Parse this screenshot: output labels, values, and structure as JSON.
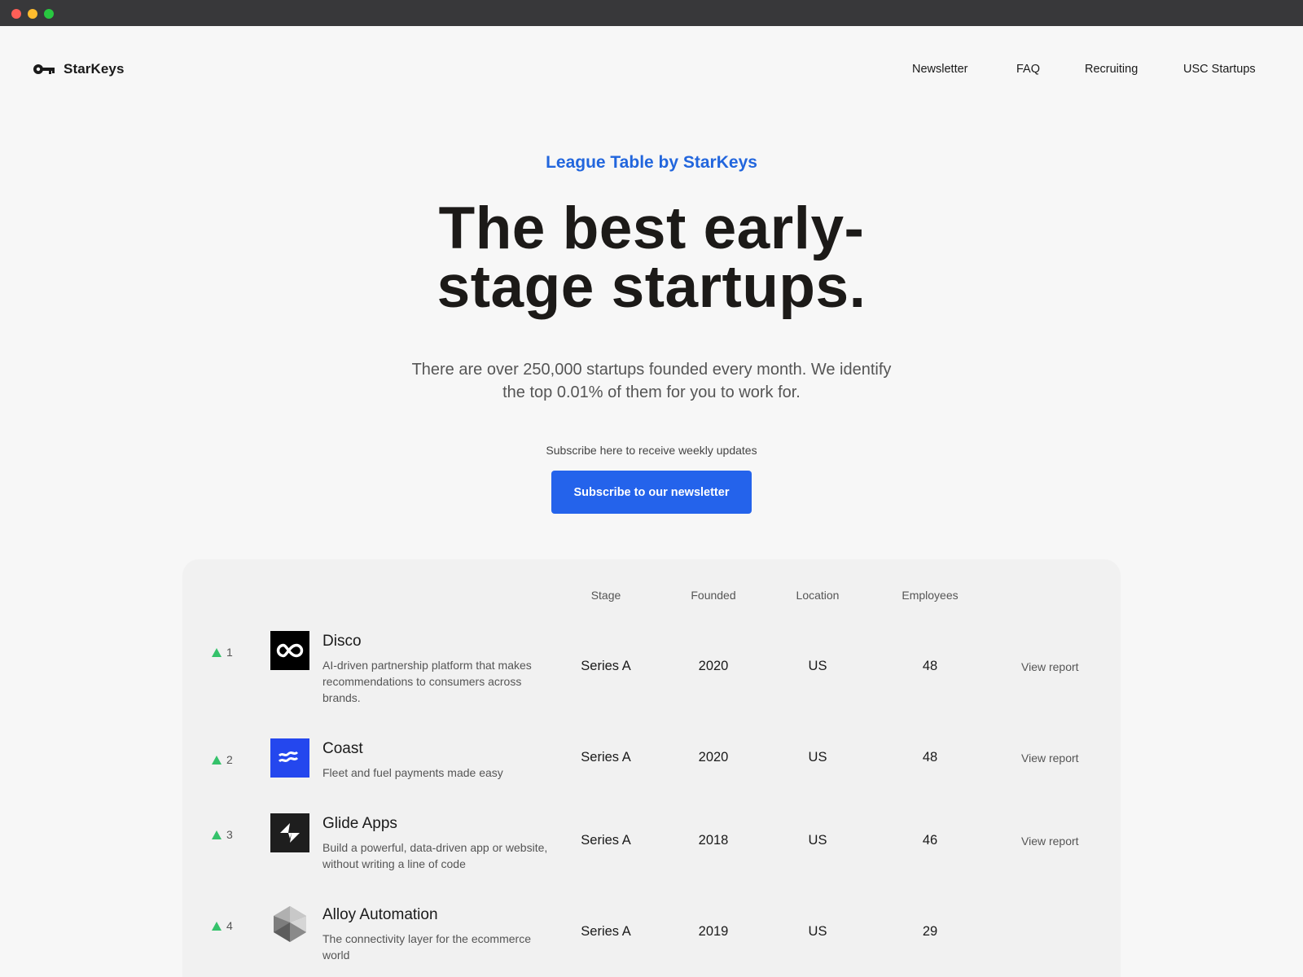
{
  "window": {
    "controls": [
      "close",
      "minimize",
      "maximize"
    ]
  },
  "brand": {
    "name": "StarKeys",
    "icon": "key-icon"
  },
  "nav": {
    "links": [
      "Newsletter",
      "FAQ",
      "Recruiting",
      "USC Startups"
    ]
  },
  "hero": {
    "eyebrow": "League Table by StarKeys",
    "headline_line1": "The best early-",
    "headline_line2": "stage startups.",
    "subhead": "There are over 250,000 startups founded every month. We identify the top 0.01% of them for you to work for.",
    "subscribe_note": "Subscribe here to receive weekly updates",
    "subscribe_button": "Subscribe to our newsletter"
  },
  "colors": {
    "accent": "#2463eb",
    "eyebrow": "#2266dd",
    "rank_up": "#35c26b"
  },
  "table": {
    "columns": [
      "Stage",
      "Founded",
      "Location",
      "Employees"
    ],
    "rows": [
      {
        "rank": "1",
        "trend": "up",
        "name": "Disco",
        "description": "AI-driven partnership platform that makes recommendations to consumers across brands.",
        "stage": "Series A",
        "founded": "2020",
        "location": "US",
        "employees": "48",
        "action": "View report",
        "logo": "infinity-icon"
      },
      {
        "rank": "2",
        "trend": "up",
        "name": "Coast",
        "description": "Fleet and fuel payments made easy",
        "stage": "Series A",
        "founded": "2020",
        "location": "US",
        "employees": "48",
        "action": "View report",
        "logo": "waves-icon"
      },
      {
        "rank": "3",
        "trend": "up",
        "name": "Glide Apps",
        "description": "Build a powerful, data-driven app or website, without writing a line of code",
        "stage": "Series A",
        "founded": "2018",
        "location": "US",
        "employees": "46",
        "action": "View report",
        "logo": "glide-icon"
      },
      {
        "rank": "4",
        "trend": "up",
        "name": "Alloy Automation",
        "description": "The connectivity layer for the ecommerce world",
        "stage": "Series A",
        "founded": "2019",
        "location": "US",
        "employees": "29",
        "action": "",
        "logo": "polyhedron-icon"
      }
    ]
  }
}
